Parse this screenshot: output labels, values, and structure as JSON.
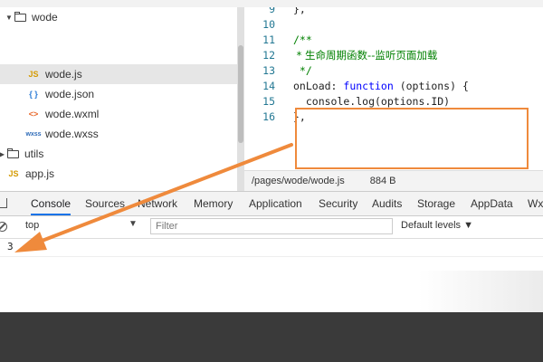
{
  "tree": {
    "items": [
      {
        "label": "wode",
        "kind": "folder",
        "expanded": true
      },
      {
        "label": "wode.js",
        "kind": "js",
        "icon_text": "JS",
        "selected": true
      },
      {
        "label": "wode.json",
        "kind": "json",
        "icon_text": "{ }"
      },
      {
        "label": "wode.wxml",
        "kind": "wxml",
        "icon_text": "<>"
      },
      {
        "label": "wode.wxss",
        "kind": "wxss",
        "icon_text": "wxss"
      },
      {
        "label": "utils",
        "kind": "folder",
        "expanded": false
      },
      {
        "label": "app.js",
        "kind": "js",
        "icon_text": "JS"
      }
    ]
  },
  "editor": {
    "lines": [
      {
        "n": "9",
        "text": "},"
      },
      {
        "n": "10",
        "text": ""
      },
      {
        "n": "11",
        "text": "/**"
      },
      {
        "n": "12",
        "text": " * 生命周期函数--监听页面加载"
      },
      {
        "n": "13",
        "text": " */"
      },
      {
        "n": "14",
        "a": "onLoad: ",
        "kw": "function",
        "b": " (options) {"
      },
      {
        "n": "15",
        "text": "  console.log(options.ID)"
      },
      {
        "n": "16",
        "text": "},"
      }
    ]
  },
  "status": {
    "path": "/pages/wode/wode.js",
    "size": "884 B"
  },
  "devtools": {
    "tabs": [
      "Console",
      "Sources",
      "Network",
      "Memory",
      "Application",
      "Security",
      "Audits",
      "Storage",
      "AppData",
      "Wx"
    ],
    "active_tab": "Console",
    "context": "top",
    "filter_placeholder": "Filter",
    "levels": "Default levels",
    "output": "3"
  },
  "colors": {
    "highlight": "#ef8a3c",
    "active_tab": "#1a73e8"
  }
}
